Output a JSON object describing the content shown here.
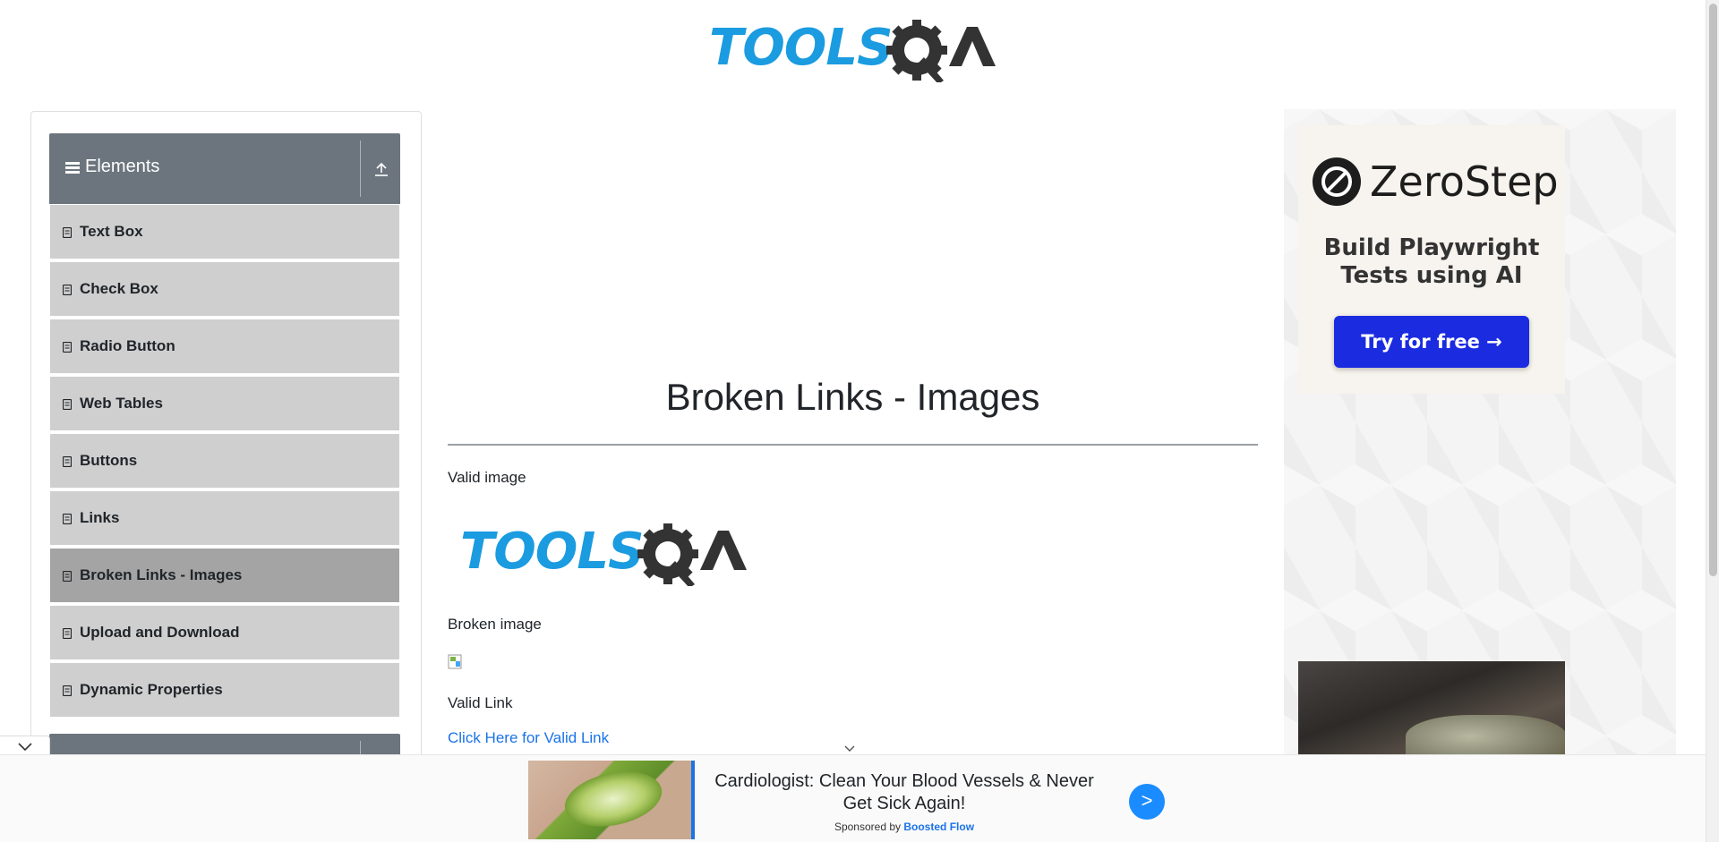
{
  "header": {
    "logo_text": "TOOLSQA"
  },
  "sidebar": {
    "group_title": "Elements",
    "items": [
      {
        "label": "Text Box"
      },
      {
        "label": "Check Box"
      },
      {
        "label": "Radio Button"
      },
      {
        "label": "Web Tables"
      },
      {
        "label": "Buttons"
      },
      {
        "label": "Links"
      },
      {
        "label": "Broken Links - Images",
        "active": true
      },
      {
        "label": "Upload and Download"
      },
      {
        "label": "Dynamic Properties"
      }
    ]
  },
  "main": {
    "title": "Broken Links - Images",
    "valid_image_label": "Valid image",
    "broken_image_label": "Broken image",
    "valid_link_label": "Valid Link",
    "valid_link_text": "Click Here for Valid Link"
  },
  "right_ad": {
    "brand": "ZeroStep",
    "tagline": "Build Playwright Tests using AI",
    "cta": "Try for free →"
  },
  "bottom_ad": {
    "headline": "Cardiologist: Clean Your Blood Vessels & Never Get Sick Again!",
    "sponsored_prefix": "Sponsored by",
    "sponsor": "Boosted Flow",
    "go_label": ">"
  },
  "colors": {
    "sidebar_header": "#6c757d",
    "menu_item": "#cfcfcf",
    "menu_item_active": "#a4a4a4",
    "link": "#1a73e8",
    "cta_blue": "#1a2be0",
    "logo_blue": "#1b9be0"
  },
  "icons": [
    "hamburger-icon",
    "collapse-icon",
    "list-item-icon",
    "broken-image-icon",
    "chevron-down-icon",
    "gear-magnifier-icon"
  ]
}
